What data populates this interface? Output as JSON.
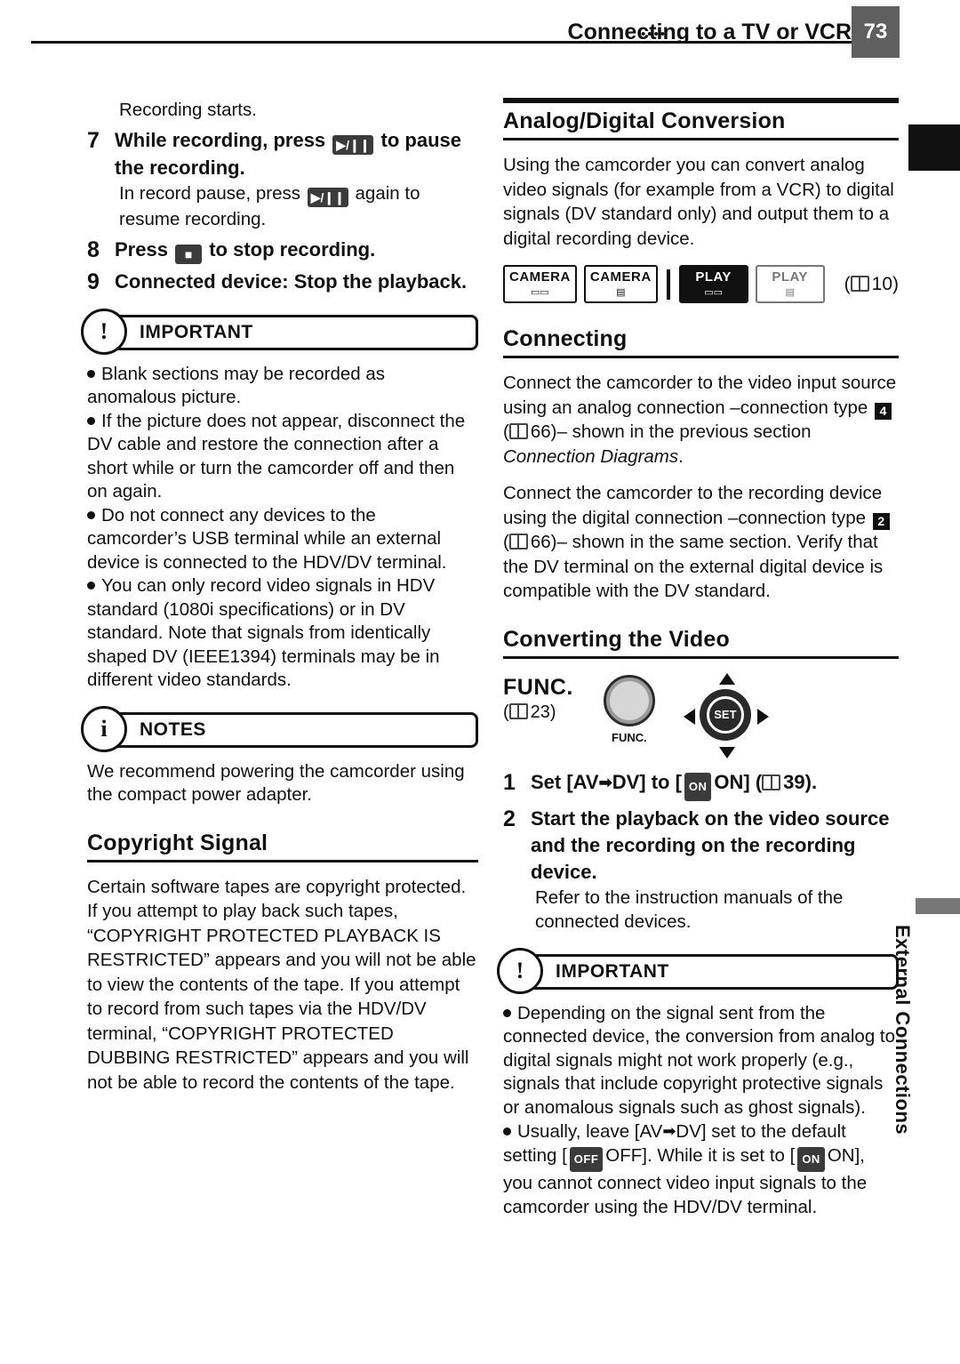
{
  "header": {
    "dots": "••••",
    "title": "Connecting to a TV or VCR",
    "page_number": "73"
  },
  "side_tab": {
    "label": "External Connections"
  },
  "left": {
    "recording_starts": "Recording starts.",
    "step7": {
      "num": "7",
      "text_before": "While recording, press",
      "icon": "play-pause-icon",
      "text_after": "to pause the recording.",
      "detail_before": "In record pause, press",
      "detail_icon": "play-pause-icon",
      "detail_after": "again to resume recording."
    },
    "step8": {
      "num": "8",
      "text_before": "Press",
      "icon": "stop-icon",
      "text_after": "to stop recording."
    },
    "step9": {
      "num": "9",
      "text": "Connected device: Stop the playback."
    },
    "important": {
      "badge": "!",
      "label": "IMPORTANT",
      "bullets": [
        "Blank sections may be recorded as anomalous picture.",
        "If the picture does not appear, disconnect the DV cable and restore the connection after a short while or turn the camcorder off and then on again.",
        "Do not connect any devices to the camcorder’s USB terminal while an external device is connected to the HDV/DV terminal.",
        "You can only record video signals in HDV standard (1080i specifications) or in DV standard. Note that signals from identically shaped DV (IEEE1394) terminals may be in different video standards."
      ]
    },
    "notes": {
      "badge": "i",
      "label": "NOTES",
      "text": "We recommend powering the camcorder using the compact power adapter."
    },
    "copyright_signal": {
      "heading": "Copyright Signal",
      "text": "Certain software tapes are copyright protected. If you attempt to play back such tapes, “COPYRIGHT PROTECTED PLAYBACK IS RESTRICTED” appears and you will not be able to view the contents of the tape. If you attempt to record from such tapes via the HDV/DV terminal, “COPYRIGHT PROTECTED DUBBING RESTRICTED” appears and you will not be able to record the contents of the tape."
    }
  },
  "right": {
    "analog_digital": {
      "heading": "Analog/Digital Conversion",
      "paragraph": "Using the camcorder you can convert analog video signals (for example from a VCR) to digital signals (DV standard only) and output them to a digital recording device."
    },
    "modes": [
      {
        "name": "CAMERA",
        "sub": "tape-icon",
        "state": "outline"
      },
      {
        "name": "CAMERA",
        "sub": "card-icon",
        "state": "outline"
      },
      {
        "name": "PLAY",
        "sub": "tape-icon",
        "state": "filled"
      },
      {
        "name": "PLAY",
        "sub": "card-icon",
        "state": "outline"
      }
    ],
    "modes_ref": "10",
    "connecting": {
      "heading": "Connecting",
      "p1_a": "Connect the camcorder to the video input source using an analog connection –connection type",
      "p1_badge": "4",
      "p1_b": "–",
      "p1_ref": "66",
      "p1_c": "shown in the previous section ",
      "p1_italic": "Connection Diagrams",
      "p1_d": ".",
      "p2_a": "Connect the camcorder to the recording device using the digital connection –connection type",
      "p2_badge": "2",
      "p2_ref": "66",
      "p2_c": "shown in the same section. Verify that the DV terminal on the external digital device is compatible with the DV standard."
    },
    "converting": {
      "heading": "Converting the Video",
      "func_label": "FUNC.",
      "func_ref": "23",
      "func_button_caption": "FUNC.",
      "joystick_label": "SET",
      "step1": {
        "num": "1",
        "a": "Set [AV",
        "arrow": "➡",
        "b": "DV] to [",
        "chip": "ON",
        "c": "ON] (",
        "ref": "39",
        "d": ")."
      },
      "step2": {
        "num": "2",
        "text": "Start the playback on the video source and the recording on the recording device.",
        "detail": "Refer to the instruction manuals of the connected devices."
      }
    },
    "important": {
      "badge": "!",
      "label": "IMPORTANT",
      "bullet1": "Depending on the signal sent from the connected device, the conversion from analog to digital signals might not work properly (e.g., signals that include copyright protective signals or anomalous signals such as ghost signals).",
      "bullet2_a": "Usually, leave [AV",
      "bullet2_arrow": "➡",
      "bullet2_b": "DV] set to the default setting [",
      "bullet2_off": "OFF",
      "bullet2_c": "OFF]. While it is set to [",
      "bullet2_on": "ON",
      "bullet2_d": "ON], you cannot connect video input signals to the camcorder using the HDV/DV terminal."
    }
  }
}
